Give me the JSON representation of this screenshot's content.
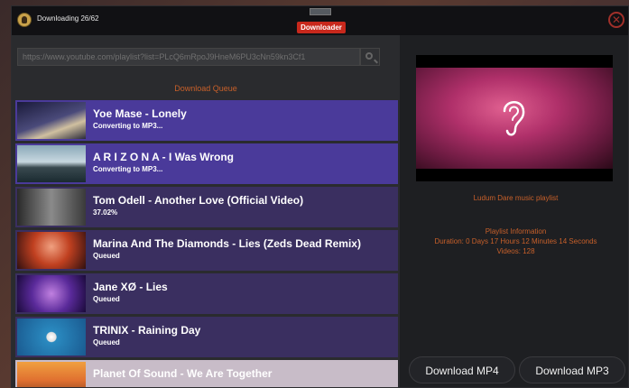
{
  "titlebar": {
    "status": "Downloading 26/62",
    "brand": "Downloader",
    "close": "✕"
  },
  "search": {
    "value": "https://www.youtube.com/playlist?list=PLcQ6mRpoJ9HneM6PU3cNn59kn3Cf1"
  },
  "queue": {
    "label": "Download Queue",
    "items": [
      {
        "title": "Yoe Mase - Lonely",
        "status": "Converting to MP3...",
        "bg": "#4a3a9a"
      },
      {
        "title": "A R I Z O N A - I Was Wrong",
        "status": "Converting to MP3...",
        "bg": "#4a3a9a"
      },
      {
        "title": "Tom Odell - Another Love (Official Video)",
        "status": "37.02%",
        "bg": "#3a2f60"
      },
      {
        "title": "Marina And The Diamonds - Lies (Zeds Dead Remix)",
        "status": "Queued",
        "bg": "#3a2f60"
      },
      {
        "title": "Jane XØ - Lies",
        "status": "Queued",
        "bg": "#3a2f60"
      },
      {
        "title": "TRINIX - Raining Day",
        "status": "Queued",
        "bg": "#3a2f60"
      },
      {
        "title": "Planet Of Sound - We Are Together",
        "status": "",
        "bg": "#c8bcc8"
      }
    ]
  },
  "right": {
    "playlist_title": "Ludum Dare music playlist",
    "info_header": "Playlist Information",
    "duration": "Duration: 0 Days 17 Hours 12 Minutes 14 Seconds",
    "videos": "Videos: 128",
    "download_mp4": "Download MP4",
    "download_mp3": "Download MP3"
  },
  "colors": {
    "accent": "#c8602a",
    "brand_red": "#c8281c",
    "queue_row": "#3a2f60",
    "active_row": "#4a3a9a"
  }
}
